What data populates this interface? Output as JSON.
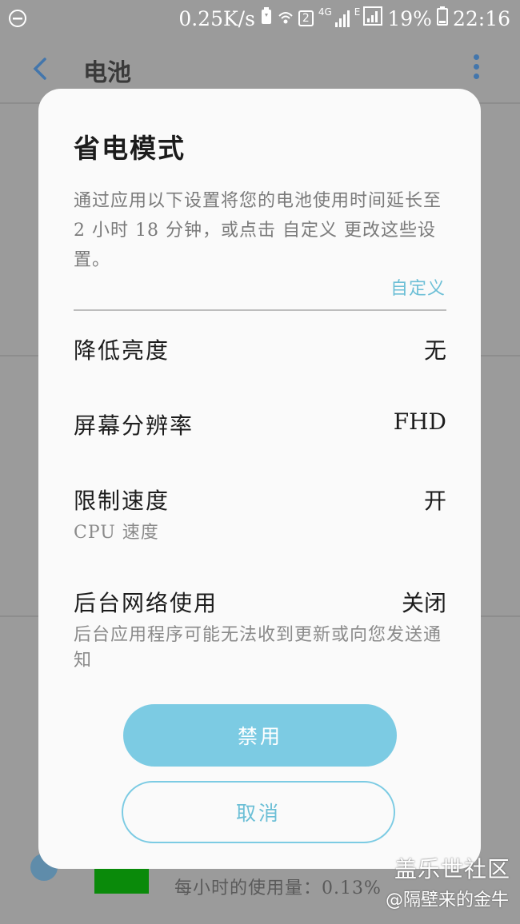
{
  "status_bar": {
    "speed": "0.25K/s",
    "sim_badge": "2",
    "network_4g": "4G",
    "network_e": "E",
    "battery": "19%",
    "time": "22:16"
  },
  "app_bar": {
    "title": "电池"
  },
  "background": {
    "usage_text": "每小时的使用量：0.13%"
  },
  "dialog": {
    "title": "省电模式",
    "description": "通过应用以下设置将您的电池使用时间延长至 2 小时 18 分钟，或点击 自定义 更改这些设置。",
    "customize_link": "自定义",
    "options": [
      {
        "label": "降低亮度",
        "value": "无",
        "sub": ""
      },
      {
        "label": "屏幕分辨率",
        "value": "FHD",
        "sub": ""
      },
      {
        "label": "限制速度",
        "value": "开",
        "sub": "CPU 速度"
      },
      {
        "label": "后台网络使用",
        "value": "关闭",
        "sub": "后台应用程序可能无法收到更新或向您发送通知"
      }
    ],
    "primary_button": "禁用",
    "secondary_button": "取消"
  },
  "watermark": {
    "brand": "盖乐世社区",
    "user": "@隔壁来的金牛"
  },
  "colors": {
    "accent": "#7ccbe3",
    "accent_text": "#6cbfd6",
    "overlay": "#9b9b9b"
  }
}
